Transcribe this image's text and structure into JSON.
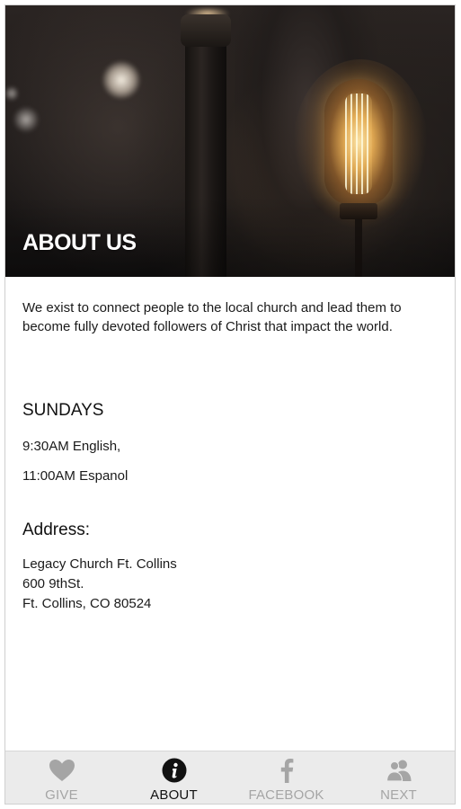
{
  "hero": {
    "title": "ABOUT US"
  },
  "about": {
    "mission": "We exist to connect people to the local church and lead them to become fully devoted followers of Christ that impact the world."
  },
  "sundays": {
    "heading": "SUNDAYS",
    "services": [
      "9:30AM English,",
      "11:00AM Espanol"
    ]
  },
  "address": {
    "heading": "Address:",
    "lines": [
      "Legacy Church Ft. Collins",
      "600 9thSt.",
      "Ft. Collins, CO 80524"
    ]
  },
  "tabbar": {
    "active_tab": "ABOUT",
    "inactive_color": "#a5a5a5",
    "active_color": "#111111",
    "tabs": [
      {
        "label": "GIVE",
        "icon": "heart-icon"
      },
      {
        "label": "ABOUT",
        "icon": "info-icon"
      },
      {
        "label": "FACEBOOK",
        "icon": "facebook-icon"
      },
      {
        "label": "NEXT",
        "icon": "people-icon"
      }
    ]
  }
}
